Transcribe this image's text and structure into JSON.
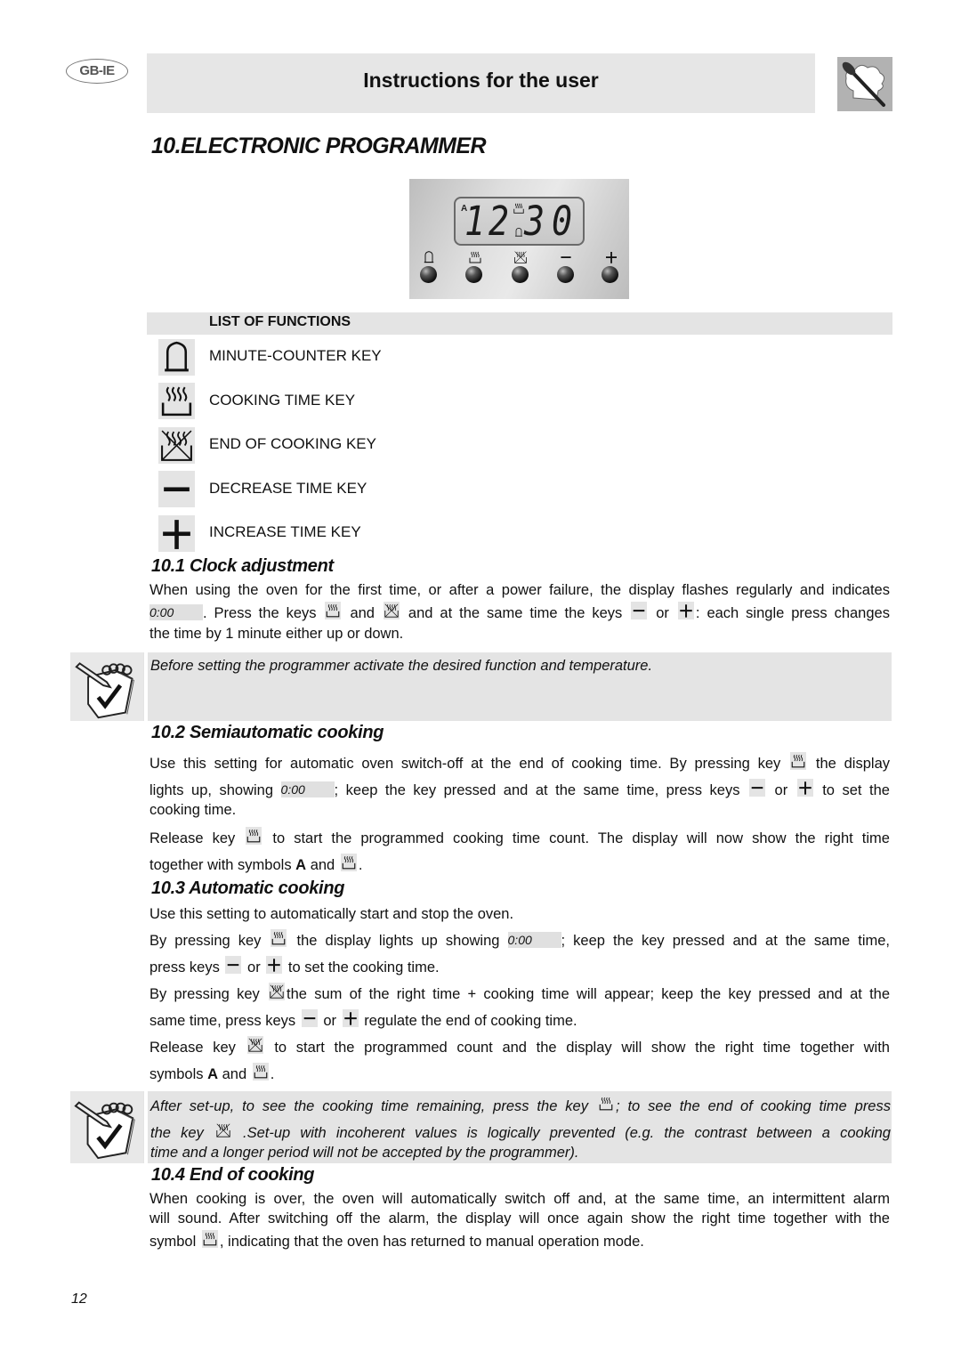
{
  "header": {
    "lang_badge": "GB-IE",
    "title": "Instructions for the user",
    "logo": "chef-hat-spoon-icon"
  },
  "main_title": "10.ELECTRONIC PROGRAMMER",
  "programmer_panel": {
    "lcd_indicator": "A",
    "lcd_time_digits": [
      "1",
      "2",
      "3",
      "0"
    ],
    "keys": [
      {
        "icon": "bell-icon",
        "label": "minute-counter"
      },
      {
        "icon": "cooking-time-icon",
        "label": "cooking-time"
      },
      {
        "icon": "end-of-cooking-icon",
        "label": "end-of-cooking"
      },
      {
        "icon": "minus-icon",
        "label": "decrease"
      },
      {
        "icon": "plus-icon",
        "label": "increase"
      }
    ]
  },
  "functions": {
    "header": "LIST OF FUNCTIONS",
    "items": [
      {
        "icon": "bell-icon",
        "label": "MINUTE-COUNTER KEY"
      },
      {
        "icon": "cooking-time-icon",
        "label": "COOKING TIME KEY"
      },
      {
        "icon": "end-of-cooking-icon",
        "label": "END OF COOKING KEY"
      },
      {
        "icon": "minus-icon",
        "label": "DECREASE TIME KEY"
      },
      {
        "icon": "plus-icon",
        "label": "INCREASE TIME KEY"
      }
    ]
  },
  "display_chip": "0:00",
  "s1": {
    "title": "10.1  Clock adjustment",
    "l1": "When using the oven for the first time, or after a power failure, the display flashes regularly and indicates",
    "l2a": ". Press the keys",
    "l2b": "and",
    "l2c": "and at the same time the keys",
    "l2d": "or",
    "l2e": ": each single press changes",
    "l3": "the time by 1 minute either up or down."
  },
  "note1": "Before setting the programmer activate the desired function and temperature.",
  "s2": {
    "title": "10.2  Semiautomatic cooking",
    "l1a": "Use this setting for automatic oven switch-off at the end of cooking time. By pressing key",
    "l1b": "the display",
    "l2a": "lights up, showing",
    "l2b": "; keep the key pressed and at the same time, press keys",
    "l2c": "or",
    "l2d": "to set the",
    "l3": "cooking time.",
    "l4a": "Release key",
    "l4b": "to start the programmed cooking time count. The display will now show the right time",
    "l5a": "together with symbols",
    "l5b": "A",
    "l5c": "and",
    "l5d": "."
  },
  "s3": {
    "title": "10.3  Automatic cooking",
    "l1": "Use this setting to automatically start and stop the oven.",
    "l2a": "By pressing key",
    "l2b": "the display lights up showing",
    "l2c": "; keep the key pressed and at the same time,",
    "l3a": "press keys",
    "l3b": "or",
    "l3c": "to set the cooking time.",
    "l4a": "By pressing key",
    "l4b": "the sum of the right time + cooking time will appear; keep the key pressed and at the",
    "l5a": "same time, press keys",
    "l5b": "or",
    "l5c": " regulate the end of cooking time.",
    "l6a": "Release key",
    "l6b": "to start the programmed count and the display will show the right time together with",
    "l7a": "symbols",
    "l7b": "A",
    "l7c": "and",
    "l7d": "."
  },
  "note2": {
    "l1a": "After set-up, to see the cooking time remaining, press the key",
    "l1b": "; to see the end of cooking time press",
    "l2a": "the key",
    "l2b": " .Set-up with incoherent values is logically prevented (e.g. the contrast between a cooking",
    "l3": "time and a longer period will not be accepted by the programmer)."
  },
  "s4": {
    "title": "10.4  End of cooking",
    "l1": "When cooking is over, the oven will automatically switch off and, at the same time, an intermittent alarm",
    "l2": "will sound. After switching off the alarm, the display will once again show the right time together with the",
    "l3a": "symbol",
    "l3b": ", indicating that the oven has returned to manual operation mode."
  },
  "page_number": "12"
}
